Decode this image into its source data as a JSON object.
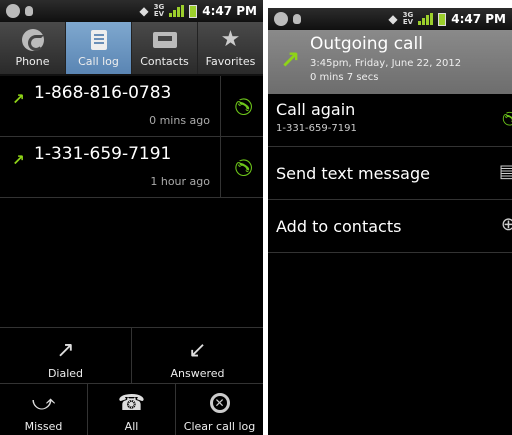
{
  "left": {
    "status": {
      "time": "4:47 PM",
      "network": "EV"
    },
    "tabs": [
      {
        "label": "Phone",
        "icon": "phone-icon"
      },
      {
        "label": "Call log",
        "icon": "call-log-icon",
        "active": true
      },
      {
        "label": "Contacts",
        "icon": "contacts-icon"
      },
      {
        "label": "Favorites",
        "icon": "star-icon"
      }
    ],
    "calls": [
      {
        "number": "1-868-816-0783",
        "when": "0 mins ago",
        "type": "outgoing"
      },
      {
        "number": "1-331-659-7191",
        "when": "1 hour ago",
        "type": "outgoing"
      }
    ],
    "filters": {
      "dialed": "Dialed",
      "answered": "Answered",
      "missed": "Missed",
      "all": "All",
      "clear": "Clear call log"
    }
  },
  "right": {
    "status": {
      "time": "4:47 PM",
      "network": "EV"
    },
    "header": {
      "title": "Outgoing call",
      "datetime": "3:45pm, Friday, June 22, 2012",
      "duration": "0 mins 7 secs"
    },
    "options": {
      "call_again": "Call again",
      "call_again_number": "1-331-659-7191",
      "send_text": "Send text message",
      "add_contact": "Add to contacts"
    }
  },
  "colors": {
    "accent_green": "#6cc41a",
    "arrow_green": "#8fd418",
    "active_tab": "#6a94c0"
  }
}
